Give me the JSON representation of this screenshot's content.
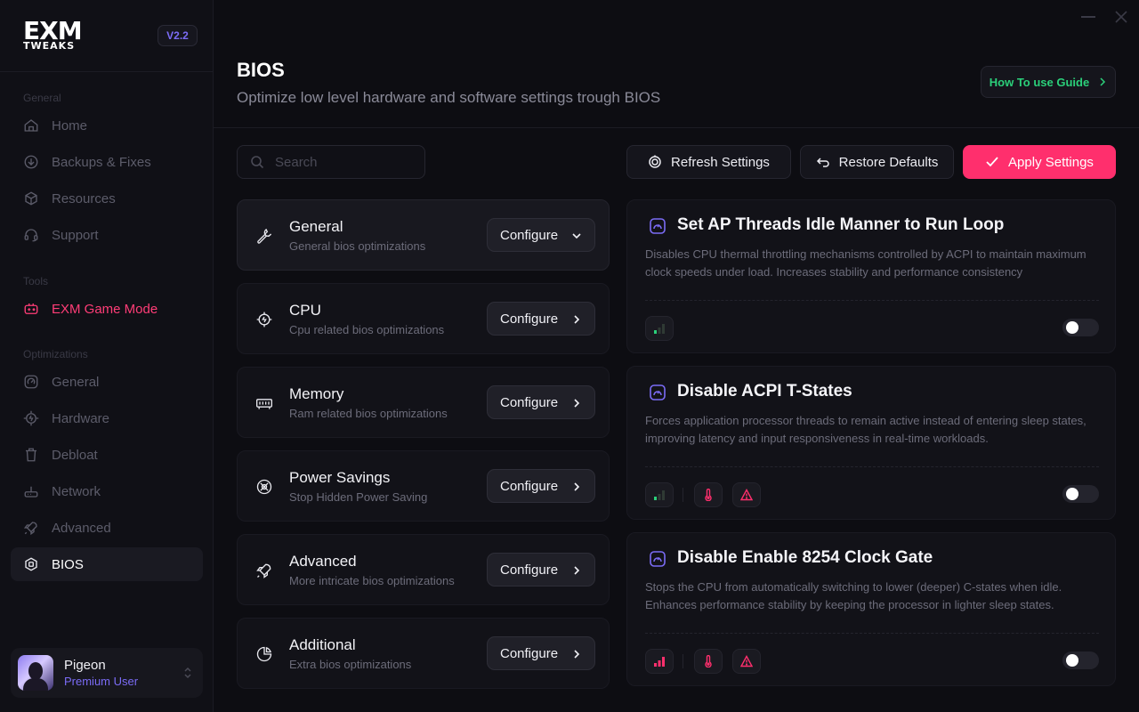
{
  "app": {
    "logo_main": "EXM",
    "logo_sub": "TWEAKS",
    "version": "V2.2"
  },
  "sidebar": {
    "sections": {
      "general": "General",
      "tools": "Tools",
      "optimizations": "Optimizations"
    },
    "general_items": [
      {
        "label": "Home",
        "icon": "home-icon"
      },
      {
        "label": "Backups & Fixes",
        "icon": "download-icon"
      },
      {
        "label": "Resources",
        "icon": "box-icon"
      },
      {
        "label": "Support",
        "icon": "headset-icon"
      }
    ],
    "tools_items": [
      {
        "label": "EXM Game Mode",
        "icon": "gamepad-icon"
      }
    ],
    "optimization_items": [
      {
        "label": "General",
        "icon": "gauge-icon"
      },
      {
        "label": "Hardware",
        "icon": "chip-icon"
      },
      {
        "label": "Debloat",
        "icon": "trash-icon"
      },
      {
        "label": "Network",
        "icon": "router-icon"
      },
      {
        "label": "Advanced",
        "icon": "rocket-icon"
      },
      {
        "label": "BIOS",
        "icon": "bios-icon",
        "active": true
      }
    ],
    "user": {
      "name": "Pigeon",
      "role": "Premium User"
    }
  },
  "header": {
    "title": "BIOS",
    "subtitle": "Optimize low level hardware and software settings trough BIOS",
    "guide_label": "How To use Guide"
  },
  "search": {
    "placeholder": "Search",
    "value": ""
  },
  "actions": {
    "refresh": "Refresh Settings",
    "restore": "Restore Defaults",
    "apply": "Apply Settings"
  },
  "categories": [
    {
      "title": "General",
      "desc": "General bios optimizations",
      "button": "Configure",
      "expanded": true,
      "icon": "wrench-icon"
    },
    {
      "title": "CPU",
      "desc": "Cpu related bios optimizations",
      "button": "Configure",
      "expanded": false,
      "icon": "cpu-icon"
    },
    {
      "title": "Memory",
      "desc": "Ram related bios optimizations",
      "button": "Configure",
      "expanded": false,
      "icon": "memory-icon"
    },
    {
      "title": "Power Savings",
      "desc": "Stop Hidden Power Saving",
      "button": "Configure",
      "expanded": false,
      "icon": "power-icon"
    },
    {
      "title": "Advanced",
      "desc": "More intricate bios optimizations",
      "button": "Configure",
      "expanded": false,
      "icon": "rocket-icon"
    },
    {
      "title": "Additional",
      "desc": "Extra bios optimizations",
      "button": "Configure",
      "expanded": false,
      "icon": "pie-icon"
    }
  ],
  "settings": [
    {
      "title": "Set AP Threads Idle Manner to Run Loop",
      "desc": "Disables CPU thermal throttling mechanisms controlled by ACPI to maintain maximum clock speeds under load. Increases stability and performance consistency",
      "impact": "low",
      "badges": [
        "signal-icon"
      ],
      "enabled": false
    },
    {
      "title": "Disable ACPI T-States",
      "desc": "Forces application processor threads to remain active instead of entering sleep states, improving latency and input responsiveness in real-time workloads.",
      "impact": "low",
      "badges": [
        "signal-icon",
        "thermometer-icon",
        "warning-icon"
      ],
      "enabled": false
    },
    {
      "title": "Disable Enable 8254 Clock Gate",
      "desc": "Stops the CPU from automatically switching to lower (deeper) C-states when idle. Enhances performance stability by keeping the processor in lighter sleep states.",
      "impact": "high",
      "badges": [
        "signal-icon",
        "thermometer-icon",
        "warning-icon"
      ],
      "enabled": false
    }
  ],
  "colors": {
    "accent": "#ff2f6d",
    "brand_purple": "#7b6cf6",
    "guide_green": "#2bd07a",
    "bg": "#0d0d12"
  }
}
